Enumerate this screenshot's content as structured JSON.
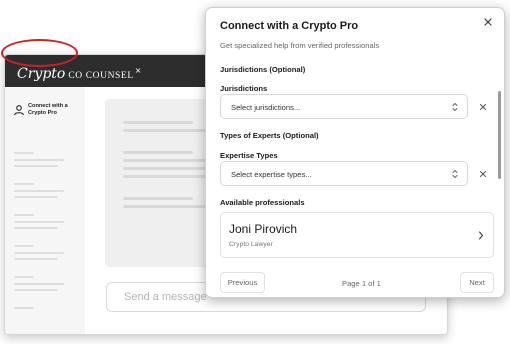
{
  "app": {
    "brand": {
      "script": "Crypto",
      "rest": "CO COUNSEL",
      "mark": "×"
    },
    "sidebar": {
      "connect_label": "Connect with a Crypto Pro"
    },
    "message_input": {
      "placeholder": "Send a message",
      "send_icon": "chevron-down-icon"
    }
  },
  "modal": {
    "title": "Connect with a Crypto Pro",
    "subtitle": "Get specialized help from verified professionals",
    "jurisdictions_section": "Jurisdictions (Optional)",
    "jurisdictions_label": "Jurisdictions",
    "jurisdictions_placeholder": "Select jurisdictions...",
    "experts_section": "Types of Experts (Optional)",
    "expertise_label": "Expertise Types",
    "expertise_placeholder": "Select expertise types...",
    "available_label": "Available professionals",
    "professionals": [
      {
        "name": "Joni Pirovich",
        "role": "Crypto Lawyer"
      }
    ],
    "pagination": {
      "previous": "Previous",
      "page_info": "Page 1 of 1",
      "next": "Next"
    }
  },
  "colors": {
    "header_bg": "#2d2d2d",
    "highlight": "#d31f1f"
  }
}
